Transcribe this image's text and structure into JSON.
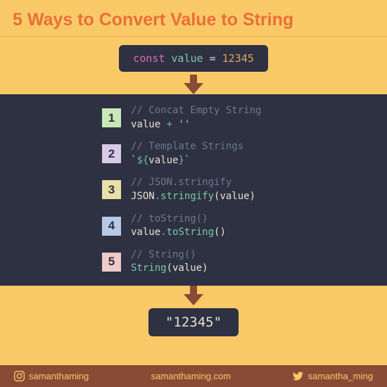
{
  "title": "5 Ways to Convert Value to String",
  "const_decl": {
    "const": "const",
    "name": "value",
    "eq": "=",
    "num": "12345"
  },
  "items": [
    {
      "num": "1",
      "comment": "// Concat Empty String",
      "code_html": "<span class='white'>value </span><span class='teal'>+</span><span class='white'> </span><span class='string'>''</span>"
    },
    {
      "num": "2",
      "comment": "// Template Strings",
      "code_html": "<span class='string'>`</span><span class='teal'>${</span><span class='white'>value</span><span class='teal'>}</span><span class='string'>`</span>"
    },
    {
      "num": "3",
      "comment": "// JSON.stringify",
      "code_html": "<span class='white'>JSON</span><span class='teal'>.</span><span class='method'>stringify</span><span class='white'>(value)</span>"
    },
    {
      "num": "4",
      "comment": "// toString()",
      "code_html": "<span class='white'>value</span><span class='teal'>.</span><span class='method'>toString</span><span class='white'>()</span>"
    },
    {
      "num": "5",
      "comment": "// String()",
      "code_html": "<span class='method'>String</span><span class='white'>(value)</span>"
    }
  ],
  "result": "\"12345\"",
  "footer": {
    "instagram": "samanthaming",
    "website": "samanthaming.com",
    "twitter": "samantha_ming"
  }
}
